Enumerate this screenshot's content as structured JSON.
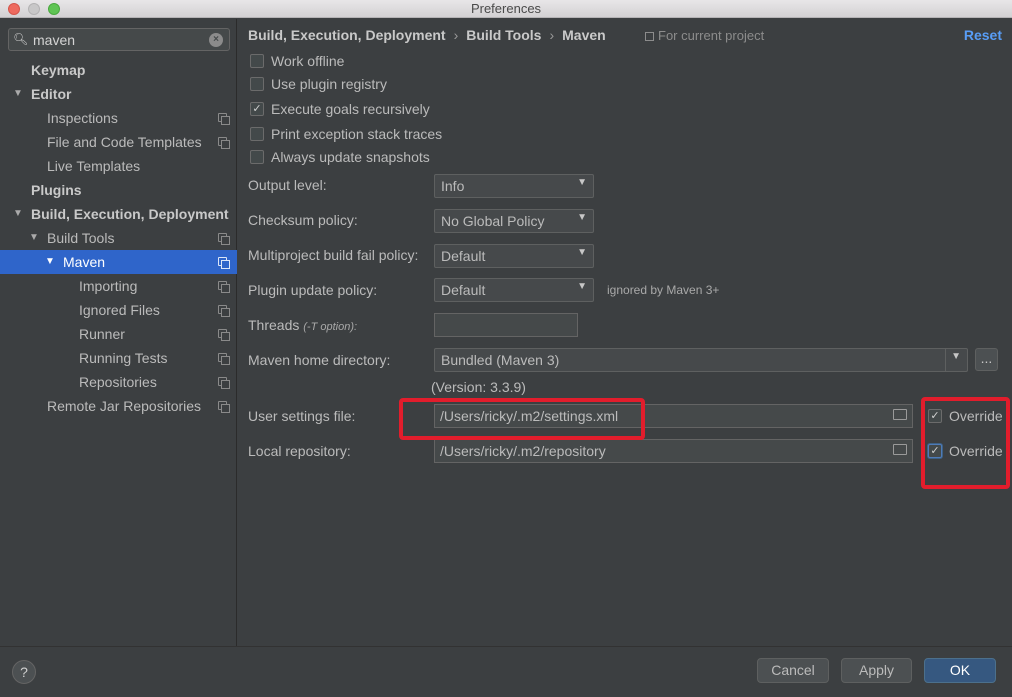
{
  "window": {
    "title": "Preferences"
  },
  "search": {
    "value": "maven",
    "icon": "search-icon",
    "clear_glyph": "×"
  },
  "tree": [
    {
      "label": "Keymap"
    },
    {
      "label": "Editor"
    },
    {
      "label": "Inspections"
    },
    {
      "label": "File and Code Templates"
    },
    {
      "label": "Live Templates"
    },
    {
      "label": "Plugins"
    },
    {
      "label": "Build, Execution, Deployment"
    },
    {
      "label": "Build Tools"
    },
    {
      "label": "Maven",
      "selected": true
    },
    {
      "label": "Importing"
    },
    {
      "label": "Ignored Files"
    },
    {
      "label": "Runner"
    },
    {
      "label": "Running Tests"
    },
    {
      "label": "Repositories"
    },
    {
      "label": "Remote Jar Repositories"
    }
  ],
  "header": {
    "crumbs": [
      "Build, Execution, Deployment",
      "Build Tools",
      "Maven"
    ],
    "separator": "›",
    "for_project": "For current project",
    "reset": "Reset"
  },
  "checkboxes": [
    {
      "label": "Work offline",
      "checked": false
    },
    {
      "label": "Use plugin registry",
      "checked": false
    },
    {
      "label": "Execute goals recursively",
      "checked": true
    },
    {
      "label": "Print exception stack traces",
      "checked": false
    },
    {
      "label": "Always update snapshots",
      "checked": false
    }
  ],
  "fields": {
    "output_level": {
      "label": "Output level:",
      "value": "Info"
    },
    "checksum_policy": {
      "label": "Checksum policy:",
      "value": "No Global Policy"
    },
    "multiproject_policy": {
      "label": "Multiproject build fail policy:",
      "value": "Default"
    },
    "plugin_update_policy": {
      "label": "Plugin update policy:",
      "value": "Default",
      "hint": "ignored by Maven 3+"
    },
    "threads": {
      "label": "Threads",
      "sublabel": "(-T option):",
      "value": ""
    },
    "maven_home": {
      "label": "Maven home directory:",
      "value": "Bundled (Maven 3)",
      "browse": "...",
      "version": "(Version: 3.3.9)"
    },
    "user_settings": {
      "label": "User settings file:",
      "value": "/Users/ricky/.m2/settings.xml",
      "override_label": "Override",
      "override": true
    },
    "local_repo": {
      "label": "Local repository:",
      "value": "/Users/ricky/.m2/repository",
      "override_label": "Override",
      "override": true
    }
  },
  "glyphs": {
    "check": "✓",
    "dropdown": "▼",
    "expanded": "▼"
  },
  "buttons": {
    "help": "?",
    "cancel": "Cancel",
    "apply": "Apply",
    "ok": "OK"
  },
  "colors": {
    "selection": "#2f65ca",
    "accent_link": "#589df6",
    "highlight_annotation": "#e21d2c",
    "primary_button": "#365880"
  }
}
